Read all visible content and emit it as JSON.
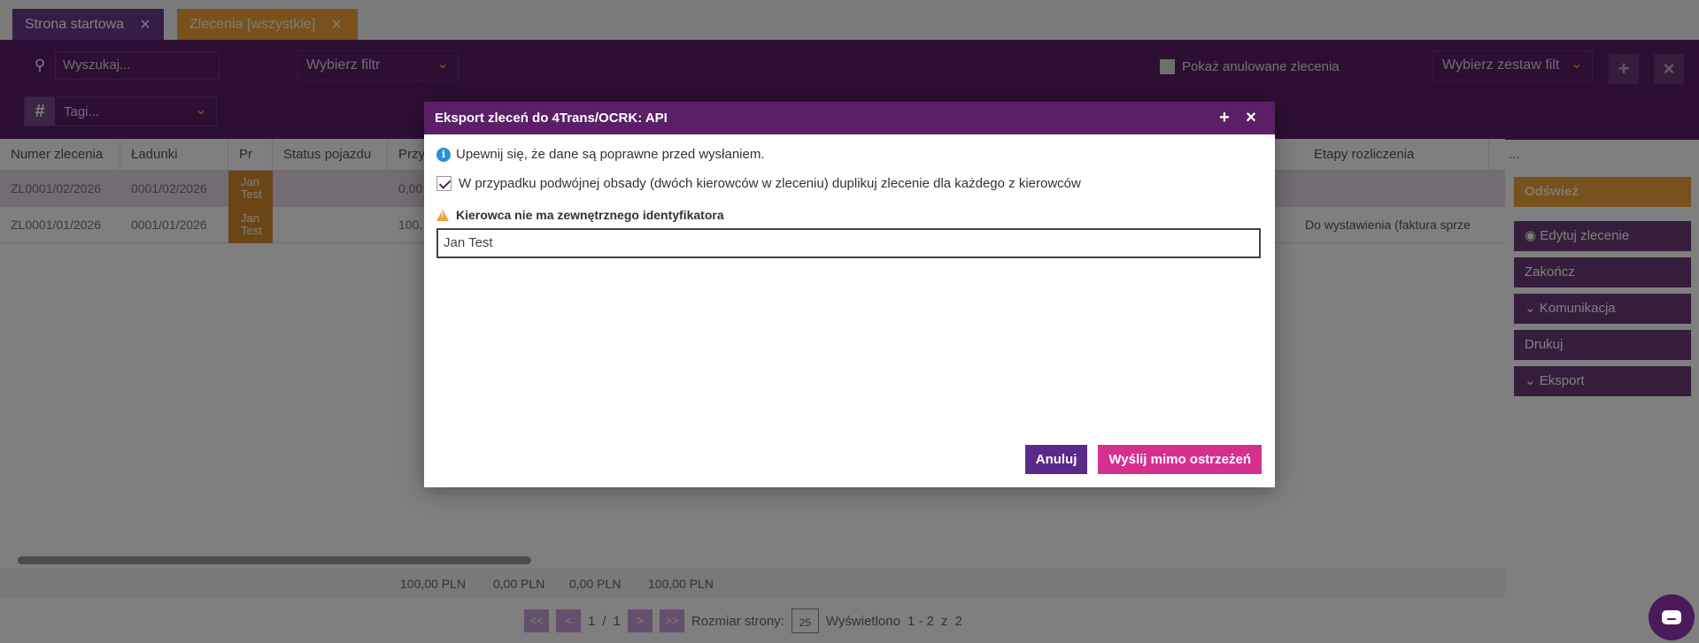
{
  "tabs": [
    {
      "label": "Strona startowa"
    },
    {
      "label": "Zlecenia [wszystkie]"
    }
  ],
  "toolbar": {
    "search_placeholder": "Wyszukaj...",
    "filter_label": "Wybierz filtr",
    "show_cancelled_label": "Pokaż anulowane zlecenia",
    "filterset_label": "Wybierz zestaw filt",
    "tags_label": "Tagi..."
  },
  "table": {
    "columns": [
      "Numer zlecenia",
      "Ładunki",
      "Pr",
      "Status pojazdu",
      "Przy",
      "Etapy rozliczenia",
      "..."
    ],
    "rows": [
      {
        "number": "ZL0001/02/2026",
        "loads": "0001/02/2026",
        "driver": "Jan Test",
        "amount": "0,00",
        "stage": ""
      },
      {
        "number": "ZL0001/01/2026",
        "loads": "0001/01/2026",
        "driver": "Jan Test",
        "amount": "100,",
        "stage": "Do wystawienia (faktura sprze"
      }
    ]
  },
  "sidebar": {
    "refresh": "Odśwież",
    "edit": "Edytuj zlecenie",
    "finish": "Zakończ",
    "communication": "Komunikacja",
    "print": "Drukuj",
    "export": "Eksport"
  },
  "sums": [
    "100,00 PLN",
    "0,00 PLN",
    "0,00 PLN",
    "100,00 PLN"
  ],
  "pager": {
    "first": "<<",
    "prev": "<",
    "page": "1",
    "sep": "/",
    "pages": "1",
    "next": ">",
    "last": ">>",
    "size_label": "Rozmiar strony:",
    "size": "25",
    "displayed": "Wyświetlono",
    "range": "1 - 2",
    "of": "z",
    "total": "2"
  },
  "modal": {
    "title": "Eksport zleceń do 4Trans/OCRK: API",
    "info": "Upewnij się, że dane są poprawne przed wysłaniem.",
    "duplicate_label": "W przypadku podwójnej obsady (dwóch kierowców w zleceniu) duplikuj zlecenie dla każdego z kierowców",
    "warning": "Kierowca nie ma zewnętrznego identyfikatora",
    "driver_value": "Jan Test",
    "cancel": "Anuluj",
    "send": "Wyślij mimo ostrzeżeń"
  }
}
